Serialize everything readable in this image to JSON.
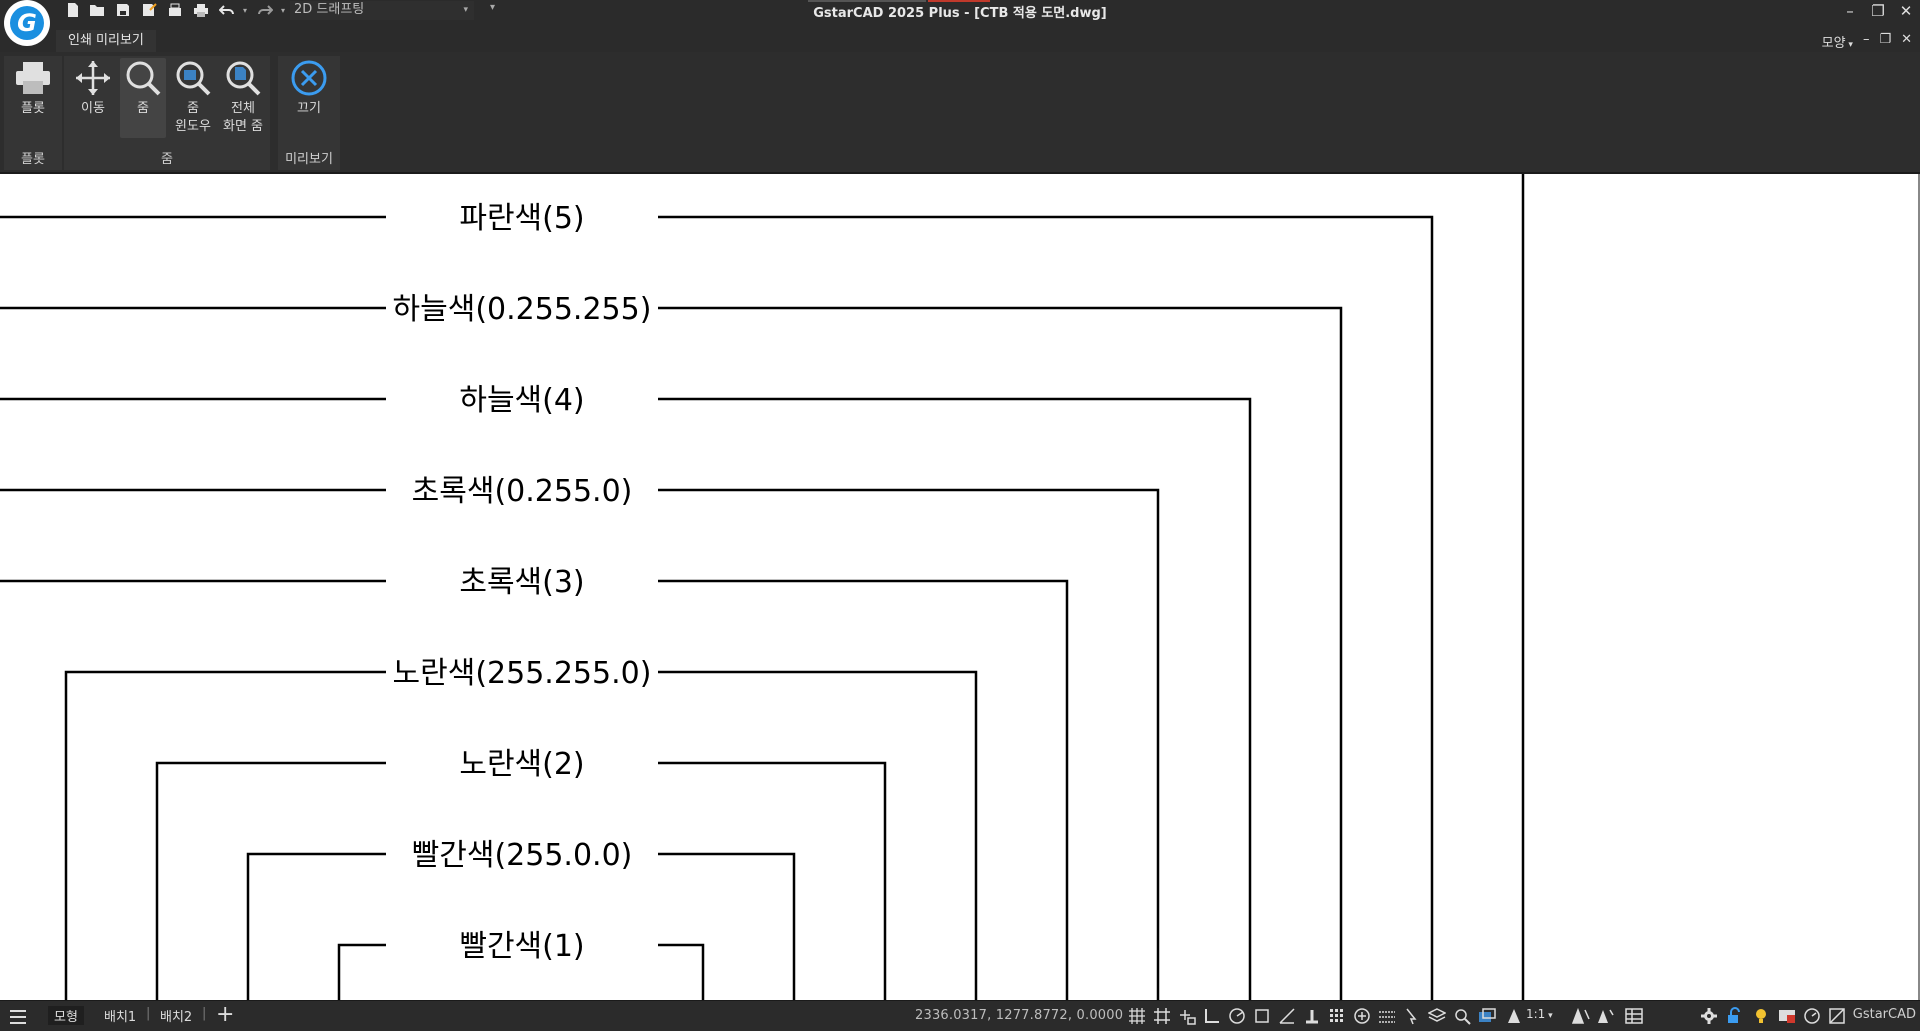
{
  "window": {
    "title": "GstarCAD 2025 Plus - [CTB 적용 도면.dwg]",
    "workspace": "2D 드래프팅",
    "controls": [
      "minimize",
      "restore",
      "close"
    ]
  },
  "quick_access_icons": [
    "new-file-icon",
    "open-folder-icon",
    "save-icon",
    "save-as-icon",
    "publish-icon",
    "print-icon",
    "undo-icon",
    "redo-icon"
  ],
  "ribbon": {
    "tab": "인쇄 미리보기",
    "layout_menu": "모양",
    "groups": [
      {
        "name": "플롯",
        "buttons": [
          {
            "label": "플롯",
            "icon": "printer-icon"
          }
        ]
      },
      {
        "name": "줌",
        "buttons": [
          {
            "label": "이동",
            "icon": "pan-icon"
          },
          {
            "label": "줌",
            "icon": "zoom-icon",
            "active": true
          },
          {
            "label": "줌\n윈도우",
            "icon": "zoom-window-icon"
          },
          {
            "label": "전체\n화면 줌",
            "icon": "zoom-extents-icon"
          }
        ]
      },
      {
        "name": "미리보기",
        "buttons": [
          {
            "label": "끄기",
            "icon": "close-preview-icon"
          }
        ]
      }
    ]
  },
  "drawing": {
    "labels": [
      "파란색(5)",
      "하늘색(0.255.255)",
      "하늘색(4)",
      "초록색(0.255.0)",
      "초록색(3)",
      "노란색(255.255.0)",
      "노란색(2)",
      "빨간색(255.0.0)",
      "빨간색(1)"
    ]
  },
  "statusbar": {
    "layout_tabs": [
      "모형",
      "배치1",
      "배치2"
    ],
    "active_tab": "모형",
    "coordinates": "2336.0317, 1277.8772, 0.0000",
    "scale": "1:1",
    "brand": "GstarCAD"
  }
}
